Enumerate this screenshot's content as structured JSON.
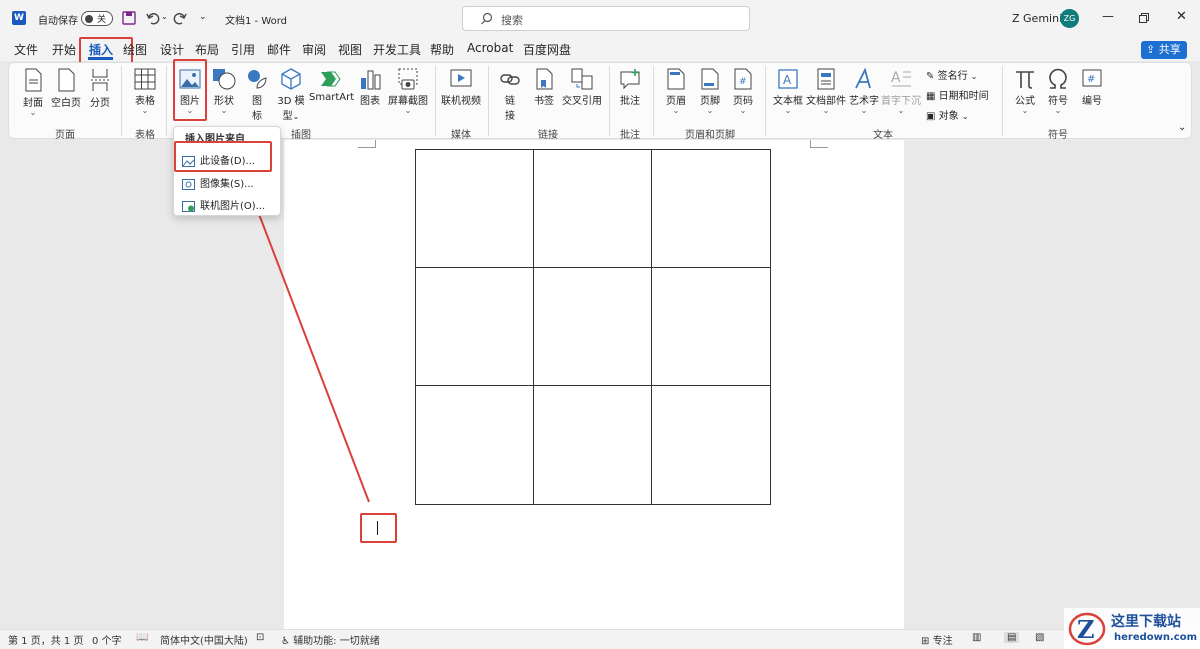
{
  "titlebar": {
    "autosave_label": "自动保存",
    "autosave_state": "关",
    "doc_title": "文档1 - Word",
    "search_placeholder": "搜索",
    "user_name": "Z Gemini",
    "user_initials": "ZG"
  },
  "tabs": [
    "文件",
    "开始",
    "插入",
    "绘图",
    "设计",
    "布局",
    "引用",
    "邮件",
    "审阅",
    "视图",
    "开发工具",
    "帮助",
    "Acrobat",
    "百度网盘"
  ],
  "share_label": "共享",
  "ribbon": {
    "cover": "封面",
    "blank_page": "空白页",
    "page_break": "分页",
    "table": "表格",
    "pictures": "图片",
    "shapes": "形状",
    "icons_1": "图",
    "icons_2": "标",
    "model3d_1": "3D 模",
    "model3d_2": "型",
    "smartart": "SmartArt",
    "chart": "图表",
    "screenshot": "屏幕截图",
    "online_video": "联机视频",
    "link_1": "链",
    "link_2": "接",
    "bookmark": "书签",
    "cross_ref": "交叉引用",
    "comment": "批注",
    "header": "页眉",
    "footer": "页脚",
    "page_number": "页码",
    "textbox": "文本框",
    "quick_parts": "文档部件",
    "wordart": "艺术字",
    "drop_cap": "首字下沉",
    "signature_line": "签名行",
    "date_time": "日期和时间",
    "object": "对象",
    "equation": "公式",
    "symbol": "符号",
    "number": "编号",
    "groups": {
      "pages": "页面",
      "tables": "表格",
      "illustrations": "插图",
      "media": "媒体",
      "links": "链接",
      "comments": "批注",
      "header_footer": "页眉和页脚",
      "text": "文本",
      "symbols": "符号"
    }
  },
  "menu": {
    "heading": "插入图片来自",
    "items": [
      "此设备(D)...",
      "图像集(S)...",
      "联机图片(O)..."
    ]
  },
  "status": {
    "page": "第 1 页，共 1 页",
    "words": "0 个字",
    "language": "简体中文(中国大陆)",
    "accessibility": "辅助功能: 一切就绪",
    "focus": "专注"
  },
  "watermark": {
    "name": "这里下载站",
    "domain": "heredown.com"
  },
  "colors": {
    "word_blue": "#185abd",
    "accent_red": "#d9413a",
    "share_blue": "#1d6fd1",
    "avatar_teal": "#0f7b7b"
  }
}
